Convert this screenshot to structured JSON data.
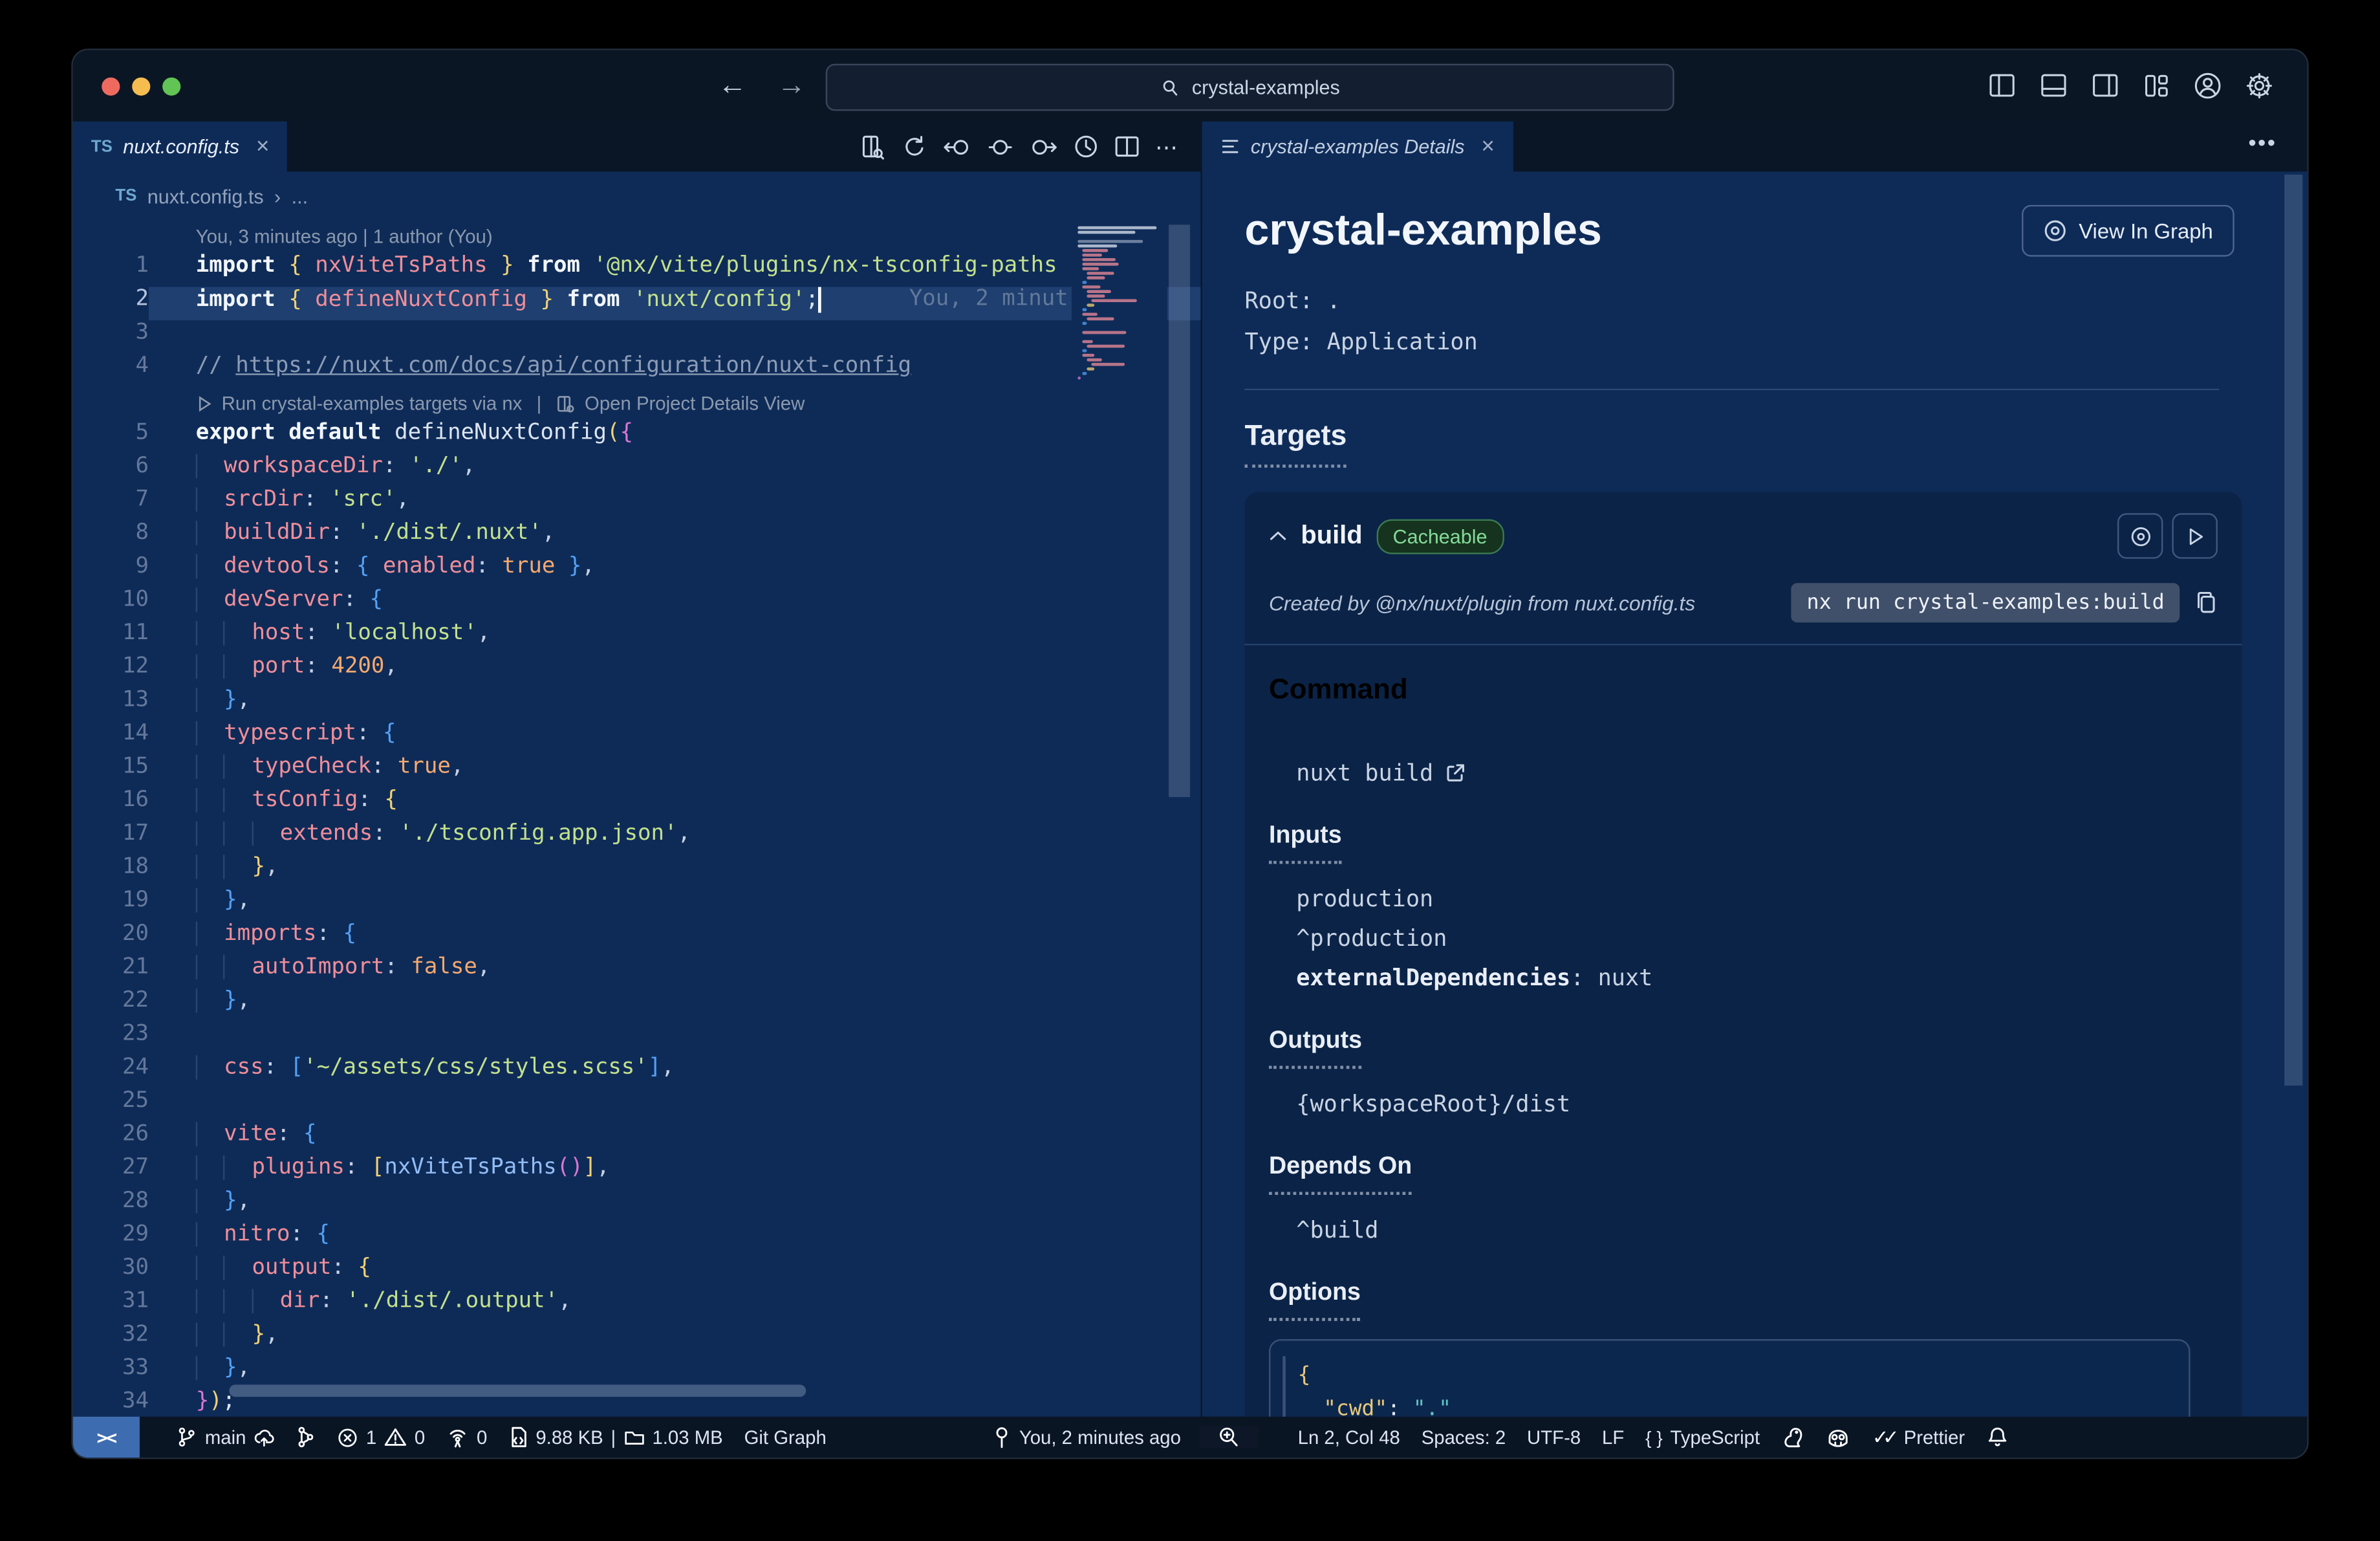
{
  "titlebar": {
    "search": "crystal-examples"
  },
  "editor": {
    "tab_badge": "TS",
    "tab_label": "nuxt.config.ts",
    "breadcrumb_file": "nuxt.config.ts",
    "breadcrumb_sep": "›",
    "breadcrumb_more": "...",
    "rows": [
      {
        "t": "lens",
        "text": "You, 3 minutes ago | 1 author (You)"
      },
      {
        "t": "c",
        "n": "1",
        "seg": [
          [
            "k",
            "import"
          ],
          [
            "w",
            " "
          ],
          [
            "y",
            "{"
          ],
          [
            "w",
            " "
          ],
          [
            "r",
            "nxViteTsPaths"
          ],
          [
            "w",
            " "
          ],
          [
            "y",
            "}"
          ],
          [
            "w",
            " "
          ],
          [
            "k",
            "from"
          ],
          [
            "w",
            " "
          ],
          [
            "s",
            "'@nx/vite/plugins/nx-tsconfig-paths"
          ]
        ]
      },
      {
        "t": "c",
        "n": "2",
        "hl": true,
        "cursor": true,
        "blame": "You, 2 minut",
        "seg": [
          [
            "k",
            "import"
          ],
          [
            "w",
            " "
          ],
          [
            "y",
            "{"
          ],
          [
            "w",
            " "
          ],
          [
            "r",
            "defineNuxtConfig"
          ],
          [
            "w",
            " "
          ],
          [
            "y",
            "}"
          ],
          [
            "w",
            " "
          ],
          [
            "k",
            "from"
          ],
          [
            "w",
            " "
          ],
          [
            "s",
            "'nuxt/config'"
          ],
          [
            "w",
            ";"
          ]
        ]
      },
      {
        "t": "c",
        "n": "3",
        "seg": []
      },
      {
        "t": "c",
        "n": "4",
        "seg": [
          [
            "c",
            "// "
          ],
          [
            "u",
            "https://nuxt.com/docs/api/configuration/nuxt-config"
          ]
        ]
      },
      {
        "t": "lens2",
        "run": "Run crystal-examples targets via nx",
        "sep": " | ",
        "open": "Open Project Details View"
      },
      {
        "t": "c",
        "n": "5",
        "seg": [
          [
            "k",
            "export"
          ],
          [
            "w",
            " "
          ],
          [
            "k",
            "default"
          ],
          [
            "w",
            " "
          ],
          [
            "w",
            "defineNuxtConfig"
          ],
          [
            "y",
            "("
          ],
          [
            "m",
            "{"
          ]
        ]
      },
      {
        "t": "c",
        "n": "6",
        "seg": [
          [
            "i",
            "  "
          ],
          [
            "r",
            "workspaceDir"
          ],
          [
            "p",
            ": "
          ],
          [
            "s",
            "'./'"
          ],
          [
            "p",
            ","
          ]
        ]
      },
      {
        "t": "c",
        "n": "7",
        "seg": [
          [
            "i",
            "  "
          ],
          [
            "r",
            "srcDir"
          ],
          [
            "p",
            ": "
          ],
          [
            "s",
            "'src'"
          ],
          [
            "p",
            ","
          ]
        ]
      },
      {
        "t": "c",
        "n": "8",
        "seg": [
          [
            "i",
            "  "
          ],
          [
            "r",
            "buildDir"
          ],
          [
            "p",
            ": "
          ],
          [
            "s",
            "'./dist/.nuxt'"
          ],
          [
            "p",
            ","
          ]
        ]
      },
      {
        "t": "c",
        "n": "9",
        "seg": [
          [
            "i",
            "  "
          ],
          [
            "r",
            "devtools"
          ],
          [
            "p",
            ": "
          ],
          [
            "b",
            "{"
          ],
          [
            "w",
            " "
          ],
          [
            "r",
            "enabled"
          ],
          [
            "p",
            ": "
          ],
          [
            "o",
            "true"
          ],
          [
            "b",
            " }"
          ],
          [
            "p",
            ","
          ]
        ]
      },
      {
        "t": "c",
        "n": "10",
        "seg": [
          [
            "i",
            "  "
          ],
          [
            "r",
            "devServer"
          ],
          [
            "p",
            ": "
          ],
          [
            "b",
            "{"
          ]
        ]
      },
      {
        "t": "c",
        "n": "11",
        "seg": [
          [
            "i",
            "  "
          ],
          [
            "i",
            "  "
          ],
          [
            "r",
            "host"
          ],
          [
            "p",
            ": "
          ],
          [
            "s",
            "'localhost'"
          ],
          [
            "p",
            ","
          ]
        ]
      },
      {
        "t": "c",
        "n": "12",
        "seg": [
          [
            "i",
            "  "
          ],
          [
            "i",
            "  "
          ],
          [
            "r",
            "port"
          ],
          [
            "p",
            ": "
          ],
          [
            "o",
            "4200"
          ],
          [
            "p",
            ","
          ]
        ]
      },
      {
        "t": "c",
        "n": "13",
        "seg": [
          [
            "i",
            "  "
          ],
          [
            "b",
            "}"
          ],
          [
            "p",
            ","
          ]
        ]
      },
      {
        "t": "c",
        "n": "14",
        "seg": [
          [
            "i",
            "  "
          ],
          [
            "r",
            "typescript"
          ],
          [
            "p",
            ": "
          ],
          [
            "b",
            "{"
          ]
        ]
      },
      {
        "t": "c",
        "n": "15",
        "seg": [
          [
            "i",
            "  "
          ],
          [
            "i",
            "  "
          ],
          [
            "r",
            "typeCheck"
          ],
          [
            "p",
            ": "
          ],
          [
            "o",
            "true"
          ],
          [
            "p",
            ","
          ]
        ]
      },
      {
        "t": "c",
        "n": "16",
        "seg": [
          [
            "i",
            "  "
          ],
          [
            "i",
            "  "
          ],
          [
            "r",
            "tsConfig"
          ],
          [
            "p",
            ": "
          ],
          [
            "y",
            "{"
          ]
        ]
      },
      {
        "t": "c",
        "n": "17",
        "seg": [
          [
            "i",
            "  "
          ],
          [
            "i",
            "  "
          ],
          [
            "i",
            "  "
          ],
          [
            "r",
            "extends"
          ],
          [
            "p",
            ": "
          ],
          [
            "s",
            "'./tsconfig.app.json'"
          ],
          [
            "p",
            ","
          ]
        ]
      },
      {
        "t": "c",
        "n": "18",
        "seg": [
          [
            "i",
            "  "
          ],
          [
            "i",
            "  "
          ],
          [
            "y",
            "}"
          ],
          [
            "p",
            ","
          ]
        ]
      },
      {
        "t": "c",
        "n": "19",
        "seg": [
          [
            "i",
            "  "
          ],
          [
            "b",
            "}"
          ],
          [
            "p",
            ","
          ]
        ]
      },
      {
        "t": "c",
        "n": "20",
        "seg": [
          [
            "i",
            "  "
          ],
          [
            "r",
            "imports"
          ],
          [
            "p",
            ": "
          ],
          [
            "b",
            "{"
          ]
        ]
      },
      {
        "t": "c",
        "n": "21",
        "seg": [
          [
            "i",
            "  "
          ],
          [
            "i",
            "  "
          ],
          [
            "r",
            "autoImport"
          ],
          [
            "p",
            ": "
          ],
          [
            "o",
            "false"
          ],
          [
            "p",
            ","
          ]
        ]
      },
      {
        "t": "c",
        "n": "22",
        "seg": [
          [
            "i",
            "  "
          ],
          [
            "b",
            "}"
          ],
          [
            "p",
            ","
          ]
        ]
      },
      {
        "t": "c",
        "n": "23",
        "seg": []
      },
      {
        "t": "c",
        "n": "24",
        "seg": [
          [
            "i",
            "  "
          ],
          [
            "r",
            "css"
          ],
          [
            "p",
            ": "
          ],
          [
            "b",
            "["
          ],
          [
            "s",
            "'~/assets/css/styles.scss'"
          ],
          [
            "b",
            "]"
          ],
          [
            "p",
            ","
          ]
        ]
      },
      {
        "t": "c",
        "n": "25",
        "seg": []
      },
      {
        "t": "c",
        "n": "26",
        "seg": [
          [
            "i",
            "  "
          ],
          [
            "r",
            "vite"
          ],
          [
            "p",
            ": "
          ],
          [
            "b",
            "{"
          ]
        ]
      },
      {
        "t": "c",
        "n": "27",
        "seg": [
          [
            "i",
            "  "
          ],
          [
            "i",
            "  "
          ],
          [
            "r",
            "plugins"
          ],
          [
            "p",
            ": "
          ],
          [
            "y",
            "["
          ],
          [
            "f",
            "nxViteTsPaths"
          ],
          [
            "m",
            "()"
          ],
          [
            "y",
            "]"
          ],
          [
            "p",
            ","
          ]
        ]
      },
      {
        "t": "c",
        "n": "28",
        "seg": [
          [
            "i",
            "  "
          ],
          [
            "b",
            "}"
          ],
          [
            "p",
            ","
          ]
        ]
      },
      {
        "t": "c",
        "n": "29",
        "seg": [
          [
            "i",
            "  "
          ],
          [
            "r",
            "nitro"
          ],
          [
            "p",
            ": "
          ],
          [
            "b",
            "{"
          ]
        ]
      },
      {
        "t": "c",
        "n": "30",
        "seg": [
          [
            "i",
            "  "
          ],
          [
            "i",
            "  "
          ],
          [
            "r",
            "output"
          ],
          [
            "p",
            ": "
          ],
          [
            "y",
            "{"
          ]
        ]
      },
      {
        "t": "c",
        "n": "31",
        "seg": [
          [
            "i",
            "  "
          ],
          [
            "i",
            "  "
          ],
          [
            "i",
            "  "
          ],
          [
            "r",
            "dir"
          ],
          [
            "p",
            ": "
          ],
          [
            "s",
            "'./dist/.output'"
          ],
          [
            "p",
            ","
          ]
        ]
      },
      {
        "t": "c",
        "n": "32",
        "seg": [
          [
            "i",
            "  "
          ],
          [
            "i",
            "  "
          ],
          [
            "y",
            "}"
          ],
          [
            "p",
            ","
          ]
        ]
      },
      {
        "t": "c",
        "n": "33",
        "seg": [
          [
            "i",
            "  "
          ],
          [
            "b",
            "}"
          ],
          [
            "p",
            ","
          ]
        ]
      },
      {
        "t": "c",
        "n": "34",
        "seg": [
          [
            "m",
            "}"
          ],
          [
            "y",
            ")"
          ],
          [
            "w",
            ";"
          ]
        ]
      }
    ]
  },
  "panel": {
    "tab_label": "crystal-examples Details",
    "title": "crystal-examples",
    "view_in_graph": "View In Graph",
    "root_line": "Root: .",
    "type_line": "Type: Application",
    "targets_heading": "Targets",
    "target": {
      "name": "build",
      "badge": "Cacheable",
      "created_by": "Created by @nx/nuxt/plugin from nuxt.config.ts",
      "command_chip": "nx run crystal-examples:build",
      "command_heading": "Command",
      "command_value": "nuxt build",
      "inputs_heading": "Inputs",
      "inputs": [
        "production",
        "^production"
      ],
      "inputs_kv_key": "externalDependencies",
      "inputs_kv_val": ": nuxt",
      "outputs_heading": "Outputs",
      "outputs": [
        "{workspaceRoot}/dist"
      ],
      "depends_heading": "Depends On",
      "depends": [
        "^build"
      ],
      "options_heading": "Options",
      "opt_open": "{",
      "opt_key": "\"cwd\"",
      "opt_sep": ": ",
      "opt_val": "\".\"",
      "opt_close": "}"
    }
  },
  "statusbar": {
    "remote": "><",
    "branch": "main",
    "errors": "1",
    "warnings": "0",
    "ports": "0",
    "file_size": "9.88 KB",
    "pipe": "|",
    "mem": "1.03 MB",
    "git_graph": "Git Graph",
    "blame": "You, 2 minutes ago",
    "line_col": "Ln 2, Col 48",
    "spaces": "Spaces: 2",
    "encoding": "UTF-8",
    "eol": "LF",
    "lang": "TypeScript",
    "formatter": "Prettier"
  }
}
